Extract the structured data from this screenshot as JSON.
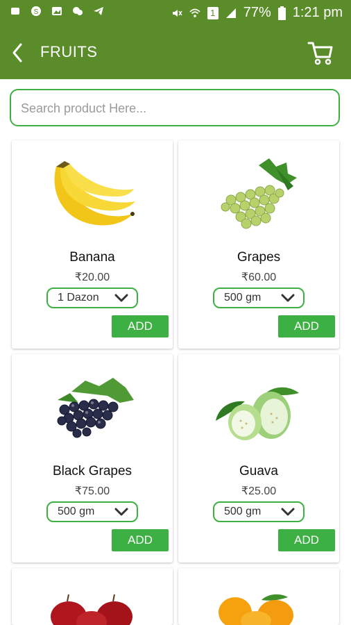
{
  "status": {
    "battery": "77%",
    "time": "1:21 pm",
    "sim": "1"
  },
  "app_bar": {
    "title": "FRUITS"
  },
  "search": {
    "placeholder": "Search product Here..."
  },
  "products": [
    {
      "name": "Banana",
      "price": "₹20.00",
      "qty": "1 Dazon",
      "add_label": "ADD"
    },
    {
      "name": "Grapes",
      "price": "₹60.00",
      "qty": "500 gm",
      "add_label": "ADD"
    },
    {
      "name": "Black Grapes",
      "price": "₹75.00",
      "qty": "500 gm",
      "add_label": "ADD"
    },
    {
      "name": "Guava",
      "price": "₹25.00",
      "qty": "500 gm",
      "add_label": "ADD"
    }
  ],
  "colors": {
    "primary": "#5a8c2a",
    "accent": "#3cb043"
  },
  "icons": {
    "back": "back-chevron-icon",
    "cart": "cart-icon",
    "dropdown": "chevron-down-icon"
  }
}
